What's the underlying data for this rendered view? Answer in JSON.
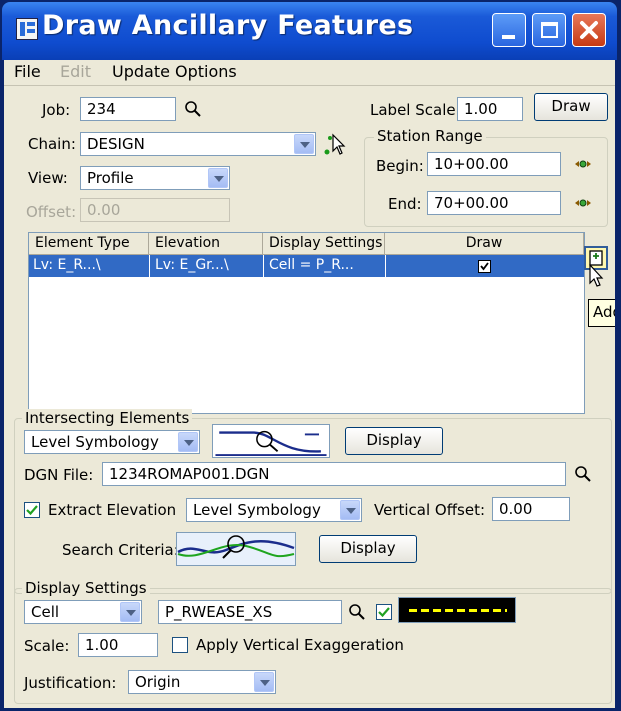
{
  "window": {
    "title": "Draw Ancillary Features"
  },
  "menu": {
    "file": "File",
    "edit": "Edit",
    "update_options": "Update Options"
  },
  "job": {
    "label": "Job:",
    "value": "234"
  },
  "chain": {
    "label": "Chain:",
    "value": "DESIGN"
  },
  "view": {
    "label": "View:",
    "value": "Profile"
  },
  "offset": {
    "label": "Offset:",
    "value": "0.00"
  },
  "label_scale": {
    "label": "Label Scale:",
    "value": "1.00"
  },
  "draw_button": "Draw",
  "station_range": {
    "title": "Station Range",
    "begin_label": "Begin:",
    "begin_value": "10+00.00",
    "end_label": "End:",
    "end_value": "70+00.00"
  },
  "table": {
    "headers": [
      "Element Type",
      "Elevation",
      "Display Settings",
      "Draw"
    ],
    "rows": [
      {
        "element_type": "Lv: E_R...\\",
        "elevation": "Lv: E_Gr...\\",
        "display": "Cell = P_R...",
        "draw": true
      }
    ]
  },
  "tooltip": "Add",
  "intersecting": {
    "title": "Intersecting Elements",
    "mode": "Level Symbology",
    "display_button": "Display",
    "dgn_label": "DGN File:",
    "dgn_value": "1234ROMAP001.DGN",
    "extract_label": "Extract Elevation",
    "extract_checked": true,
    "extract_mode": "Level Symbology",
    "vertical_offset_label": "Vertical Offset:",
    "vertical_offset_value": "0.00",
    "search_label": "Search Criteria:",
    "search_button": "Display"
  },
  "display_settings": {
    "title": "Display Settings",
    "type": "Cell",
    "cell_name": "P_RWEASE_XS",
    "symbology_checked": true,
    "scale_label": "Scale:",
    "scale_value": "1.00",
    "apply_vert_label": "Apply Vertical Exaggeration",
    "apply_vert_checked": false,
    "justification_label": "Justification:",
    "justification_value": "Origin"
  },
  "colors": {
    "title_blue": "#0f4ccf",
    "selection": "#316ac5",
    "line_preview_bg": "#000000",
    "line_preview_dash": "#ffff00"
  }
}
